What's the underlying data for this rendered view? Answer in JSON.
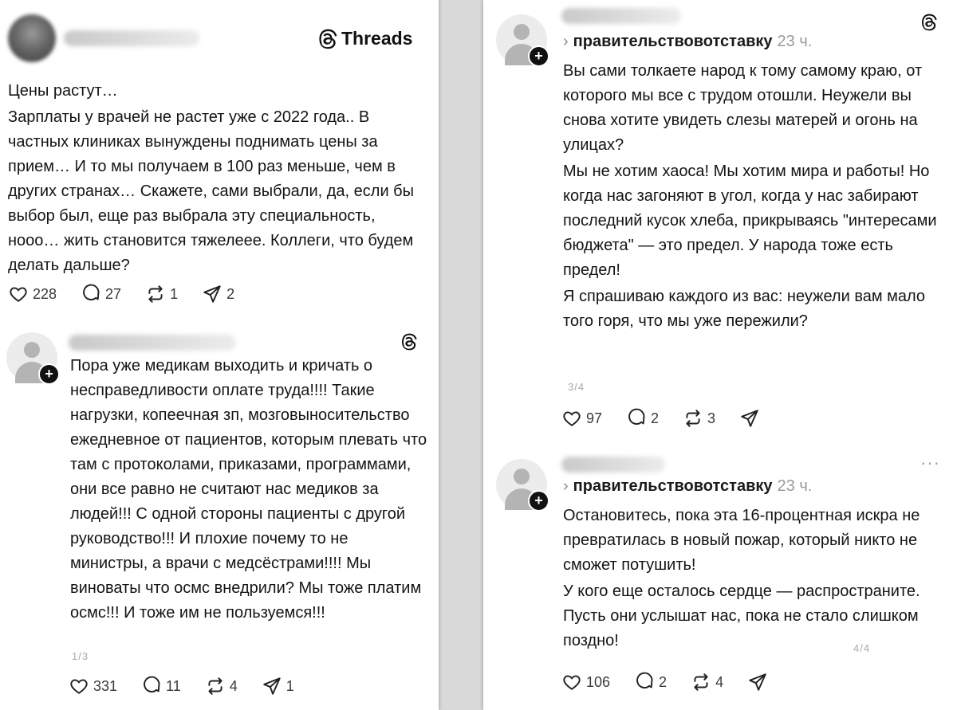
{
  "left_card": {
    "brand": "Threads",
    "paragraphs": [
      "Цены растут…",
      "Зарплаты у врачей не растет уже с 2022 года.. В частных клиниках вынуждены поднимать цены за прием… И то мы получаем в 100 раз меньше, чем в других странах… Скажете, сами выбрали, да, если бы выбор был, еще раз выбрала эту специальность, ноoo… жить становится тяжелееe. Коллеги, что будем делать дальше?"
    ],
    "actions": {
      "likes": "228",
      "comments": "27",
      "reposts": "1",
      "shares": "2"
    }
  },
  "left_reply": {
    "text": "Пора уже медикам выходить и кричать о несправедливости оплате труда!!!! Такие нагрузки, копеечная зп, мозговыносительство ежедневное от пациентов, которым плевать что там с протоколами, приказами, программами, они все равно не считают нас медиков за людей!!! С одной стороны пациенты с другой руководство!!! И плохие почему то не министры, а врачи с медсёстрами!!!! Мы виноваты что осмс внедрили? Мы тоже платим осмс!!! И тоже им не пользуемся!!!",
    "pager": "1/3",
    "actions": {
      "likes": "331",
      "comments": "11",
      "reposts": "4",
      "shares": "1"
    }
  },
  "right_post_1": {
    "reply_to": "правительствовотставку",
    "time": "23 ч.",
    "paragraphs": [
      "Вы сами толкаете народ к тому самому краю, от которого мы все с трудом отошли. Неужели вы снова хотите увидеть слезы матерей и огонь на улицах?",
      "Мы не хотим хаоса! Мы хотим мира и работы! Но когда нас загоняют в угол, когда у нас забирают последний кусок хлеба, прикрываясь \"интересами бюджета\" — это предел. У народа тоже есть предел!",
      "Я спрашиваю каждого из вас: неужели вам мало того горя, что мы уже пережили?"
    ],
    "pager": "3/4",
    "actions": {
      "likes": "97",
      "comments": "2",
      "reposts": "3"
    }
  },
  "right_post_2": {
    "reply_to": "правительствовотставку",
    "time": "23 ч.",
    "more": "···",
    "paragraphs": [
      "Остановитесь, пока эта 16-процентная искра не превратилась в новый пожар, который никто не сможет потушить!",
      "У кого еще осталось сердце — распространите. Пусть они услышат нас, пока не стало слишком поздно!"
    ],
    "pager": "4/4",
    "actions": {
      "likes": "106",
      "comments": "2",
      "reposts": "4"
    }
  },
  "icons": [
    "threads-icon",
    "heart-icon",
    "comment-icon",
    "repost-icon",
    "share-icon",
    "avatar-icon",
    "plus-icon",
    "chevron-right-icon",
    "more-icon"
  ]
}
